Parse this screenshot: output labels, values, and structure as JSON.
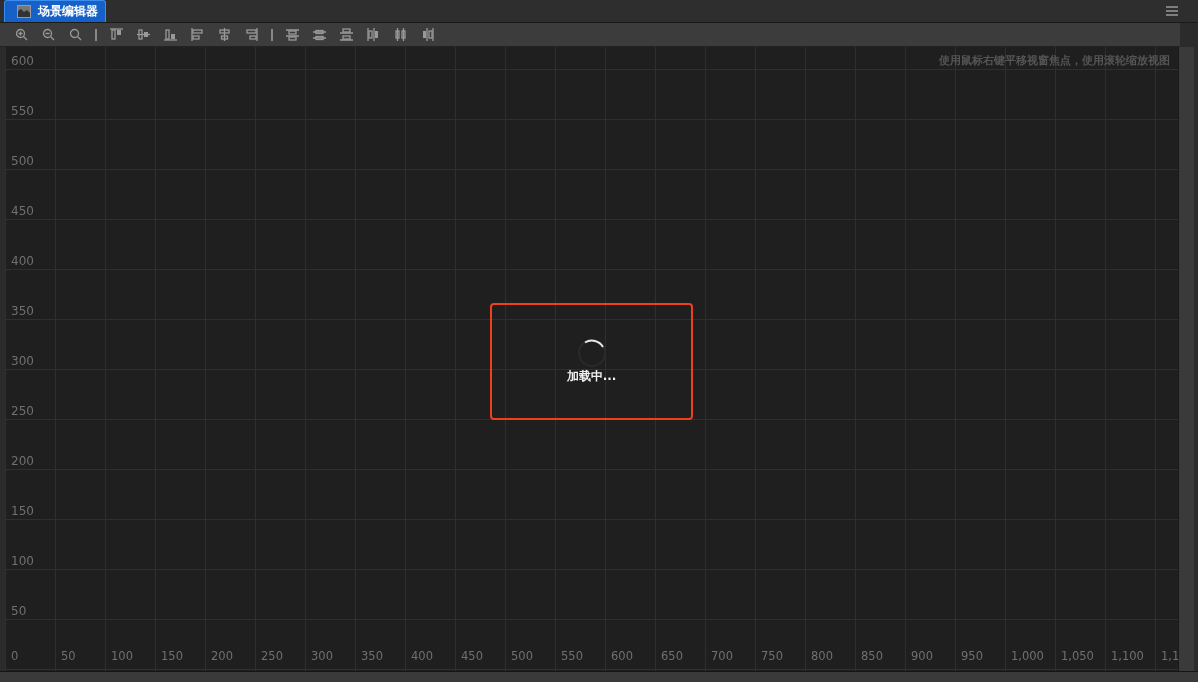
{
  "tab": {
    "title": "场景编辑器",
    "selected": true
  },
  "canvas": {
    "hint": "使用鼠标右键平移视窗焦点，使用滚轮缩放视图",
    "y_axis_labels": [
      "600",
      "550",
      "500",
      "450",
      "400",
      "350",
      "300",
      "250",
      "200",
      "150",
      "100",
      "50"
    ],
    "x_axis_labels": [
      "0",
      "50",
      "100",
      "150",
      "200",
      "250",
      "300",
      "350",
      "400",
      "450",
      "500",
      "550",
      "600",
      "650",
      "700",
      "750",
      "800",
      "850",
      "900",
      "950",
      "1,000",
      "1,050",
      "1,100",
      "1,1"
    ],
    "loading": {
      "text": "加载中..."
    }
  }
}
